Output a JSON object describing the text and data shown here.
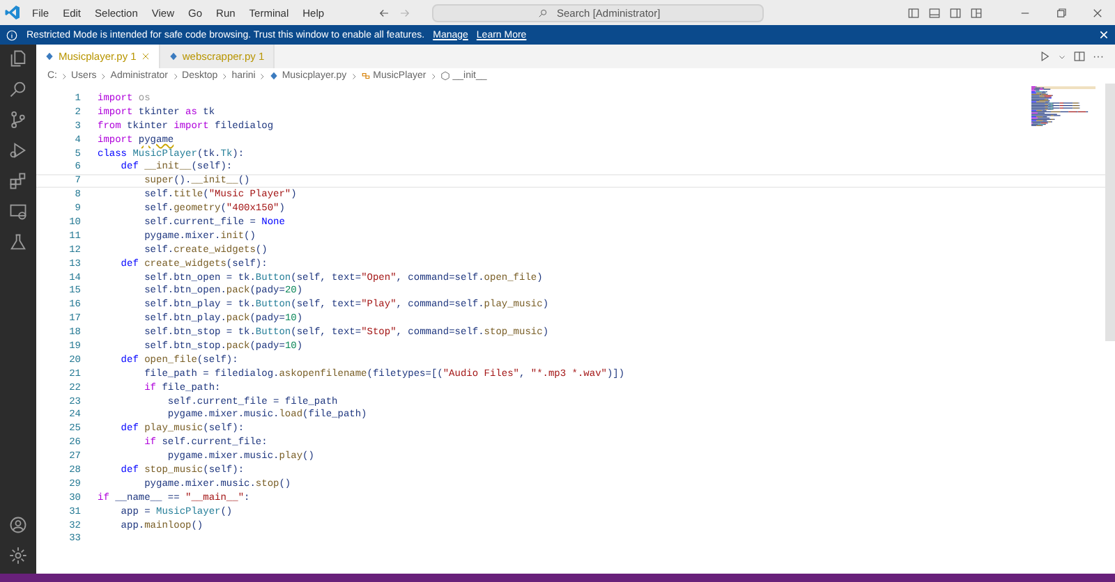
{
  "menu": [
    "File",
    "Edit",
    "Selection",
    "View",
    "Go",
    "Run",
    "Terminal",
    "Help"
  ],
  "search": {
    "placeholder": "Search [Administrator]"
  },
  "banner": {
    "message": "Restricted Mode is intended for safe code browsing. Trust this window to enable all features.",
    "links": [
      "Manage",
      "Learn More"
    ]
  },
  "tabs": [
    {
      "label": "Musicplayer.py 1",
      "selected": true
    },
    {
      "label": "webscrapper.py 1",
      "selected": false
    }
  ],
  "editor_actions": {
    "more": "···"
  },
  "breadcrumb": [
    {
      "kind": "folder",
      "text": "C:"
    },
    {
      "kind": "folder",
      "text": "Users"
    },
    {
      "kind": "folder",
      "text": "Administrator"
    },
    {
      "kind": "folder",
      "text": "Desktop"
    },
    {
      "kind": "folder",
      "text": "harini"
    },
    {
      "kind": "file",
      "text": "Musicplayer.py"
    },
    {
      "kind": "class",
      "text": "MusicPlayer"
    },
    {
      "kind": "method",
      "text": "__init__"
    }
  ],
  "code": [
    {
      "number": "1",
      "current": false,
      "tokens": [
        {
          "kind": "kw",
          "text": "import "
        },
        {
          "kind": "faded",
          "text": "os"
        }
      ]
    },
    {
      "number": "2",
      "current": false,
      "tokens": [
        {
          "kind": "kw",
          "text": "import"
        },
        {
          "kind": "plain",
          "text": " tkinter "
        },
        {
          "kind": "kw",
          "text": "as"
        },
        {
          "kind": "plain",
          "text": " tk"
        }
      ]
    },
    {
      "number": "3",
      "current": false,
      "tokens": [
        {
          "kind": "kw",
          "text": "from"
        },
        {
          "kind": "plain",
          "text": " tkinter "
        },
        {
          "kind": "kw",
          "text": "import"
        },
        {
          "kind": "plain",
          "text": " filedialog"
        }
      ]
    },
    {
      "number": "4",
      "current": false,
      "tokens": [
        {
          "kind": "kw",
          "text": "import "
        },
        {
          "kind": "warn",
          "text": "pygame"
        }
      ]
    },
    {
      "number": "5",
      "current": false,
      "tokens": [
        {
          "kind": "decl",
          "text": "class "
        },
        {
          "kind": "cls",
          "text": "MusicPlayer"
        },
        {
          "kind": "plain",
          "text": "(tk."
        },
        {
          "kind": "cls",
          "text": "Tk"
        },
        {
          "kind": "plain",
          "text": "):"
        }
      ]
    },
    {
      "number": "6",
      "current": false,
      "tokens": [
        {
          "kind": "decl",
          "text": "    def "
        },
        {
          "kind": "func",
          "text": "__init__"
        },
        {
          "kind": "plain",
          "text": "(self):"
        }
      ]
    },
    {
      "number": "7",
      "current": true,
      "tokens": [
        {
          "kind": "func",
          "text": "        super"
        },
        {
          "kind": "plain",
          "text": "()."
        },
        {
          "kind": "func",
          "text": "__init__"
        },
        {
          "kind": "plain",
          "text": "()"
        }
      ]
    },
    {
      "number": "8",
      "current": false,
      "tokens": [
        {
          "kind": "plain",
          "text": "        self."
        },
        {
          "kind": "func",
          "text": "title"
        },
        {
          "kind": "plain",
          "text": "("
        },
        {
          "kind": "str",
          "text": "\"Music Player\""
        },
        {
          "kind": "plain",
          "text": ")"
        }
      ]
    },
    {
      "number": "9",
      "current": false,
      "tokens": [
        {
          "kind": "plain",
          "text": "        self."
        },
        {
          "kind": "func",
          "text": "geometry"
        },
        {
          "kind": "plain",
          "text": "("
        },
        {
          "kind": "str",
          "text": "\"400x150\""
        },
        {
          "kind": "plain",
          "text": ")"
        }
      ]
    },
    {
      "number": "10",
      "current": false,
      "tokens": [
        {
          "kind": "plain",
          "text": "        self.current_file = "
        },
        {
          "kind": "decl",
          "text": "None"
        }
      ]
    },
    {
      "number": "11",
      "current": false,
      "tokens": [
        {
          "kind": "plain",
          "text": "        pygame.mixer."
        },
        {
          "kind": "func",
          "text": "init"
        },
        {
          "kind": "plain",
          "text": "()"
        }
      ]
    },
    {
      "number": "12",
      "current": false,
      "tokens": [
        {
          "kind": "plain",
          "text": "        self."
        },
        {
          "kind": "func",
          "text": "create_widgets"
        },
        {
          "kind": "plain",
          "text": "()"
        }
      ]
    },
    {
      "number": "13",
      "current": false,
      "tokens": [
        {
          "kind": "decl",
          "text": "    def "
        },
        {
          "kind": "func",
          "text": "create_widgets"
        },
        {
          "kind": "plain",
          "text": "(self):"
        }
      ]
    },
    {
      "number": "14",
      "current": false,
      "tokens": [
        {
          "kind": "plain",
          "text": "        self.btn_open = tk."
        },
        {
          "kind": "cls",
          "text": "Button"
        },
        {
          "kind": "plain",
          "text": "(self, text="
        },
        {
          "kind": "str",
          "text": "\"Open\""
        },
        {
          "kind": "plain",
          "text": ", command=self."
        },
        {
          "kind": "func",
          "text": "open_file"
        },
        {
          "kind": "plain",
          "text": ")"
        }
      ]
    },
    {
      "number": "15",
      "current": false,
      "tokens": [
        {
          "kind": "plain",
          "text": "        self.btn_open."
        },
        {
          "kind": "func",
          "text": "pack"
        },
        {
          "kind": "plain",
          "text": "(pady="
        },
        {
          "kind": "num",
          "text": "20"
        },
        {
          "kind": "plain",
          "text": ")"
        }
      ]
    },
    {
      "number": "16",
      "current": false,
      "tokens": [
        {
          "kind": "plain",
          "text": "        self.btn_play = tk."
        },
        {
          "kind": "cls",
          "text": "Button"
        },
        {
          "kind": "plain",
          "text": "(self, text="
        },
        {
          "kind": "str",
          "text": "\"Play\""
        },
        {
          "kind": "plain",
          "text": ", command=self."
        },
        {
          "kind": "func",
          "text": "play_music"
        },
        {
          "kind": "plain",
          "text": ")"
        }
      ]
    },
    {
      "number": "17",
      "current": false,
      "tokens": [
        {
          "kind": "plain",
          "text": "        self.btn_play."
        },
        {
          "kind": "func",
          "text": "pack"
        },
        {
          "kind": "plain",
          "text": "(pady="
        },
        {
          "kind": "num",
          "text": "10"
        },
        {
          "kind": "plain",
          "text": ")"
        }
      ]
    },
    {
      "number": "18",
      "current": false,
      "tokens": [
        {
          "kind": "plain",
          "text": "        self.btn_stop = tk."
        },
        {
          "kind": "cls",
          "text": "Button"
        },
        {
          "kind": "plain",
          "text": "(self, text="
        },
        {
          "kind": "str",
          "text": "\"Stop\""
        },
        {
          "kind": "plain",
          "text": ", command=self."
        },
        {
          "kind": "func",
          "text": "stop_music"
        },
        {
          "kind": "plain",
          "text": ")"
        }
      ]
    },
    {
      "number": "19",
      "current": false,
      "tokens": [
        {
          "kind": "plain",
          "text": "        self.btn_stop."
        },
        {
          "kind": "func",
          "text": "pack"
        },
        {
          "kind": "plain",
          "text": "(pady="
        },
        {
          "kind": "num",
          "text": "10"
        },
        {
          "kind": "plain",
          "text": ")"
        }
      ]
    },
    {
      "number": "20",
      "current": false,
      "tokens": [
        {
          "kind": "decl",
          "text": "    def "
        },
        {
          "kind": "func",
          "text": "open_file"
        },
        {
          "kind": "plain",
          "text": "(self):"
        }
      ]
    },
    {
      "number": "21",
      "current": false,
      "tokens": [
        {
          "kind": "plain",
          "text": "        file_path = filedialog."
        },
        {
          "kind": "func",
          "text": "askopenfilename"
        },
        {
          "kind": "plain",
          "text": "(filetypes=[("
        },
        {
          "kind": "str",
          "text": "\"Audio Files\""
        },
        {
          "kind": "plain",
          "text": ", "
        },
        {
          "kind": "str",
          "text": "\"*.mp3 *.wav\""
        },
        {
          "kind": "plain",
          "text": ")])"
        }
      ]
    },
    {
      "number": "22",
      "current": false,
      "tokens": [
        {
          "kind": "kw",
          "text": "        if"
        },
        {
          "kind": "plain",
          "text": " file_path:"
        }
      ]
    },
    {
      "number": "23",
      "current": false,
      "tokens": [
        {
          "kind": "plain",
          "text": "            self.current_file = file_path"
        }
      ]
    },
    {
      "number": "24",
      "current": false,
      "tokens": [
        {
          "kind": "plain",
          "text": "            pygame.mixer.music."
        },
        {
          "kind": "func",
          "text": "load"
        },
        {
          "kind": "plain",
          "text": "(file_path)"
        }
      ]
    },
    {
      "number": "25",
      "current": false,
      "tokens": [
        {
          "kind": "decl",
          "text": "    def "
        },
        {
          "kind": "func",
          "text": "play_music"
        },
        {
          "kind": "plain",
          "text": "(self):"
        }
      ]
    },
    {
      "number": "26",
      "current": false,
      "tokens": [
        {
          "kind": "kw",
          "text": "        if"
        },
        {
          "kind": "plain",
          "text": " self.current_file:"
        }
      ]
    },
    {
      "number": "27",
      "current": false,
      "tokens": [
        {
          "kind": "plain",
          "text": "            pygame.mixer.music."
        },
        {
          "kind": "func",
          "text": "play"
        },
        {
          "kind": "plain",
          "text": "()"
        }
      ]
    },
    {
      "number": "28",
      "current": false,
      "tokens": [
        {
          "kind": "decl",
          "text": "    def "
        },
        {
          "kind": "func",
          "text": "stop_music"
        },
        {
          "kind": "plain",
          "text": "(self):"
        }
      ]
    },
    {
      "number": "29",
      "current": false,
      "tokens": [
        {
          "kind": "plain",
          "text": "        pygame.mixer.music."
        },
        {
          "kind": "func",
          "text": "stop"
        },
        {
          "kind": "plain",
          "text": "()"
        }
      ]
    },
    {
      "number": "30",
      "current": false,
      "tokens": [
        {
          "kind": "kw",
          "text": "if"
        },
        {
          "kind": "plain",
          "text": " __name__ == "
        },
        {
          "kind": "str",
          "text": "\"__main__\""
        },
        {
          "kind": "plain",
          "text": ":"
        }
      ]
    },
    {
      "number": "31",
      "current": false,
      "tokens": [
        {
          "kind": "plain",
          "text": "    app = "
        },
        {
          "kind": "cls",
          "text": "MusicPlayer"
        },
        {
          "kind": "plain",
          "text": "()"
        }
      ]
    },
    {
      "number": "32",
      "current": false,
      "tokens": [
        {
          "kind": "plain",
          "text": "    app."
        },
        {
          "kind": "func",
          "text": "mainloop"
        },
        {
          "kind": "plain",
          "text": "()"
        }
      ]
    },
    {
      "number": "33",
      "current": false
    }
  ]
}
